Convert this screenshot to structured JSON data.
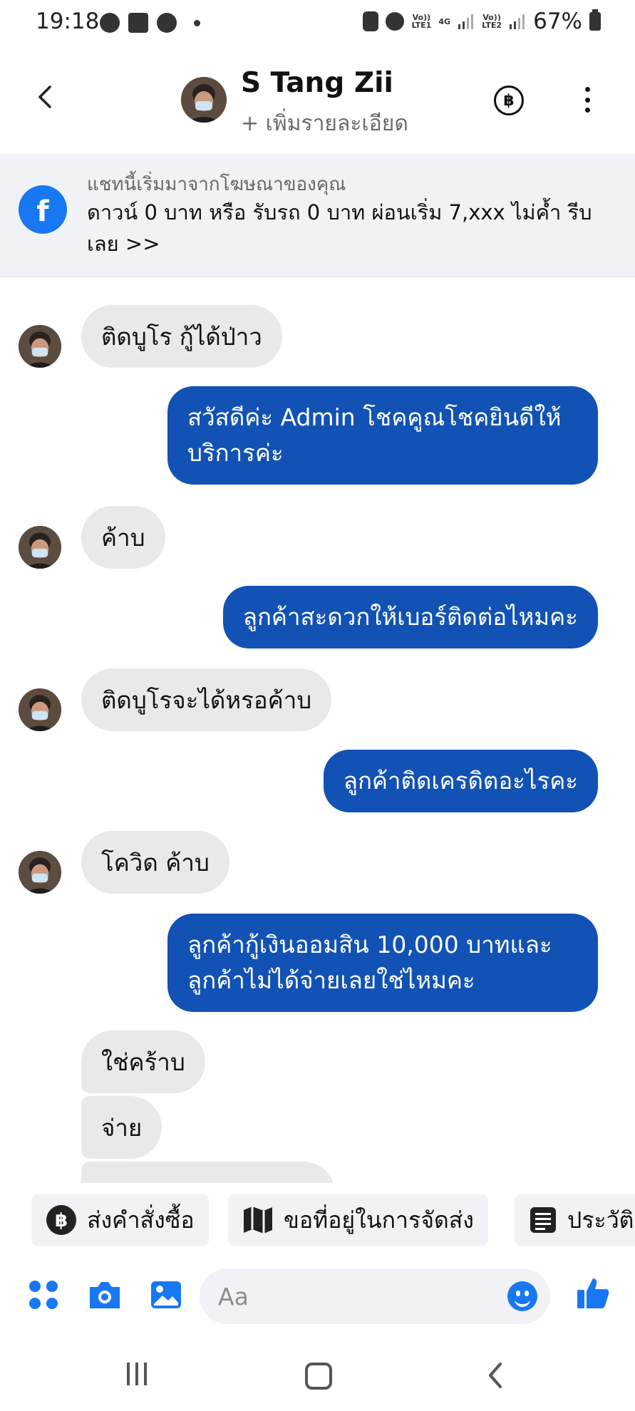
{
  "status_bar": {
    "time": "19:18",
    "left_icons": [
      "messenger-icon",
      "gallery-icon",
      "messenger-icon",
      "dot-icon"
    ],
    "net1": "Vo)) LTE1",
    "net_4g": "4G",
    "net2": "Vo)) LTE2",
    "battery": "67%"
  },
  "header": {
    "name": "S Tang Zii",
    "subtitle": "+ เพิ่มรายละเอียด",
    "baht_icon": "฿"
  },
  "ad_banner": {
    "caption": "แชทนี้เริ่มมาจากโฆษณาของคุณ",
    "text": "ดาวน์ 0 บาท หรือ รับรถ 0 บาท ผ่อนเริ่ม 7,xxx ไม่ค้ำ รีบเลย >>"
  },
  "messages": [
    {
      "from": "contact",
      "text": "ติดบูโร กู้ได้ป่าว"
    },
    {
      "from": "me",
      "text": "สวัสดีค่ะ Admin โชคคูณโชคยินดีให้บริการค่ะ"
    },
    {
      "from": "contact",
      "text": "ค้าบ"
    },
    {
      "from": "me",
      "text": "ลูกค้าสะดวกให้เบอร์ติดต่อไหมคะ"
    },
    {
      "from": "contact",
      "text": "ติดบูโรจะได้หรอค้าบ"
    },
    {
      "from": "me",
      "text": "ลูกค้าติดเครดิตอะไรคะ"
    },
    {
      "from": "contact",
      "text": "โควิด ค้าบ"
    },
    {
      "from": "me",
      "text": "ลูกค้ากู้เงินออมสิน 10,000 บาทและลูกค้าไม่ได้จ่ายเลยใช่ไหมคะ"
    },
    {
      "from": "contact",
      "text": "ใช่คร้าบ"
    },
    {
      "from": "contact",
      "text": "จ่าย"
    }
  ],
  "quick_replies": [
    {
      "label": "ส่งคำสั่งซื้อ",
      "icon": "baht-circle-icon"
    },
    {
      "label": "ขอที่อยู่ในการจัดส่ง",
      "icon": "map-icon"
    },
    {
      "label": "ประวัติ",
      "icon": "document-icon"
    }
  ],
  "composer": {
    "placeholder": "Aa"
  },
  "colors": {
    "outgoing_bubble": "#1252b5",
    "incoming_bubble": "#e9e9eb",
    "accent": "#1877f2"
  }
}
